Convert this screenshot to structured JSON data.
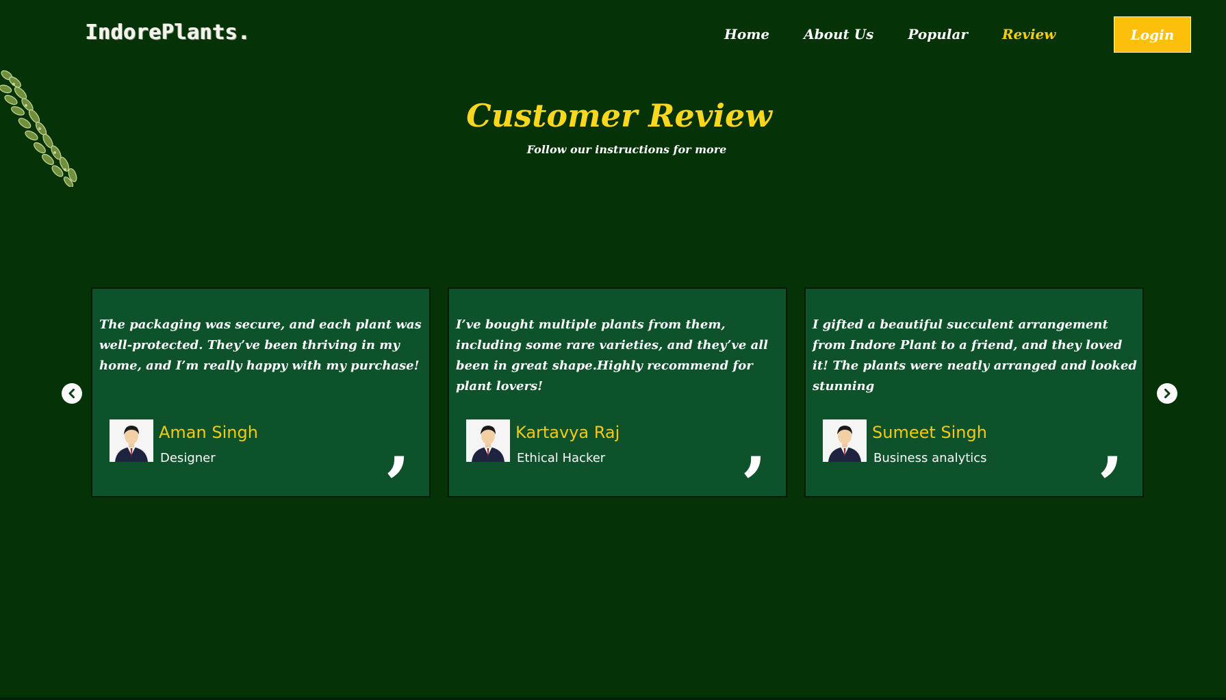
{
  "header": {
    "logo": "IndorePlants.",
    "nav": [
      {
        "label": "Home",
        "active": false
      },
      {
        "label": "About Us",
        "active": false
      },
      {
        "label": "Popular",
        "active": false
      },
      {
        "label": "Review",
        "active": true
      }
    ],
    "login_label": "Login"
  },
  "section": {
    "title": "Customer Review",
    "subtitle": "Follow our instructions for more"
  },
  "reviews": [
    {
      "text": "The packaging was secure, and each plant was well-protected. They’ve been thriving in my home, and I’m really happy with my purchase!",
      "name": "Aman Singh",
      "role": "Designer"
    },
    {
      "text": "I’ve bought multiple plants from them, including some rare varieties, and they’ve all been in great shape.Highly recommend for plant lovers!",
      "name": "Kartavya Raj",
      "role": "Ethical Hacker"
    },
    {
      "text": "I gifted a beautiful succulent arrangement from Indore Plant to a friend, and they loved it! The plants were neatly arranged and looked stunning",
      "name": "Sumeet Singh",
      "role": "Business analytics"
    }
  ],
  "quote_mark": ",",
  "colors": {
    "background": "#063208",
    "card": "#0e522c",
    "accent": "#fbd71e",
    "login": "#fdc00a"
  },
  "icons": {
    "prev": "chevron-left-circle-icon",
    "next": "chevron-right-circle-icon",
    "avatar": "businessman-avatar-icon"
  }
}
